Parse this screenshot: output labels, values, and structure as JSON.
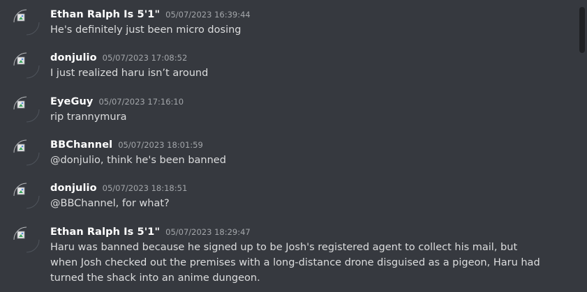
{
  "messages": [
    {
      "author": "Ethan Ralph Is 5'1\"",
      "timestamp": "05/07/2023 16:39:44",
      "content": "He's definitely just been micro dosing"
    },
    {
      "author": "donjulio",
      "timestamp": "05/07/2023 17:08:52",
      "content": "I just realized haru isn’t around"
    },
    {
      "author": "EyeGuy",
      "timestamp": "05/07/2023 17:16:10",
      "content": "rip trannymura"
    },
    {
      "author": "BBChannel",
      "timestamp": "05/07/2023 18:01:59",
      "content": "@donjulio, think he's been banned"
    },
    {
      "author": "donjulio",
      "timestamp": "05/07/2023 18:18:51",
      "content": "@BBChannel, for what?"
    },
    {
      "author": "Ethan Ralph Is 5'1\"",
      "timestamp": "05/07/2023 18:29:47",
      "content": "Haru was banned because he signed up to be Josh's registered agent to collect his mail, but when Josh checked out the premises with a long-distance drone disguised as a pigeon, Haru had turned the shack into an anime dungeon."
    }
  ],
  "icons": {
    "avatar": "broken-image-avatar-icon"
  },
  "colors": {
    "background": "#36393f",
    "author": "#ffffff",
    "timestamp": "#a3a6aa",
    "content": "#dcddde"
  }
}
